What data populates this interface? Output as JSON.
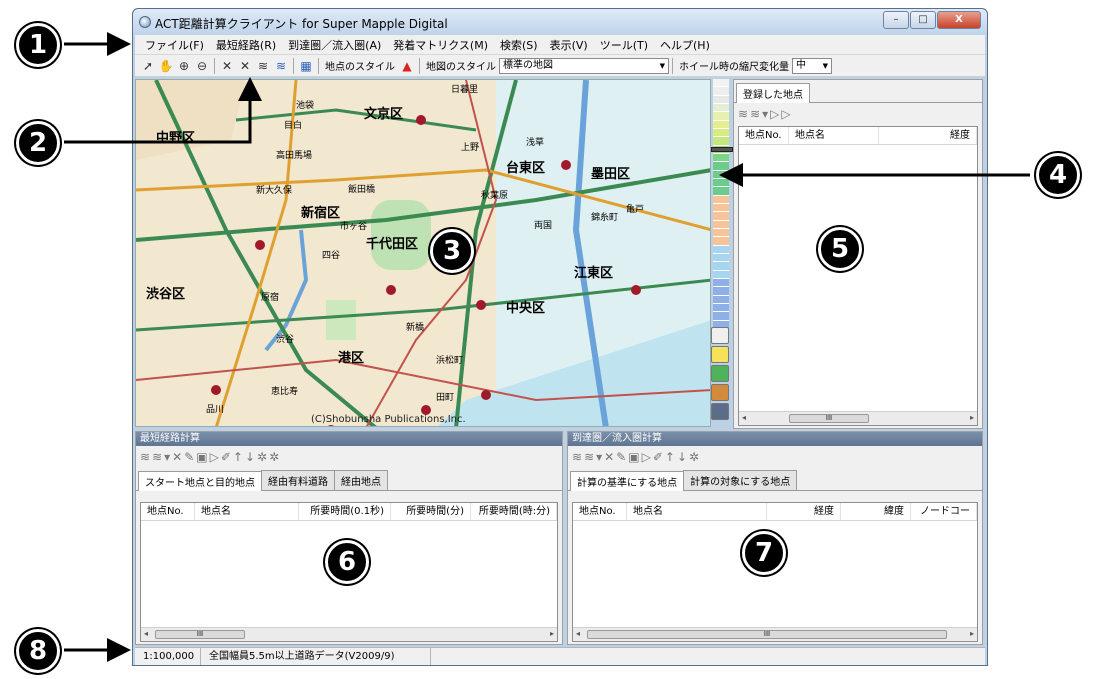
{
  "window": {
    "title": "ACT距離計算クライアント for Super Mapple Digital",
    "controls": [
      "–",
      "□",
      "X"
    ]
  },
  "menu": [
    "ファイル(F)",
    "最短経路(R)",
    "到達圏／流入圏(A)",
    "発着マトリクス(M)",
    "検索(S)",
    "表示(V)",
    "ツール(T)",
    "ヘルプ(H)"
  ],
  "toolbar": {
    "point_style_label": "地点のスタイル",
    "map_style_label": "地図のスタイル",
    "map_style_value": "標準の地図",
    "wheel_label": "ホイール時の縮尺変化量",
    "wheel_value": "中"
  },
  "map": {
    "copyright": "(C)Shobunsha Publications,Inc.",
    "labels": [
      "中野区",
      "文京区",
      "台東区",
      "墨田区",
      "新宿区",
      "千代田区",
      "江東区",
      "渋谷区",
      "中央区",
      "港区",
      "目白",
      "新大久保",
      "飯田橋",
      "市ヶ谷",
      "秋葉原",
      "上野",
      "浅草",
      "日暮里",
      "両国",
      "新橋",
      "浜松町",
      "恵比寿",
      "原宿",
      "渋谷",
      "四谷",
      "高田馬場",
      "池袋",
      "亀戸",
      "錦糸町",
      "田町",
      "品川"
    ]
  },
  "registered_panel": {
    "tab": "登録した地点",
    "columns": [
      "地点No.",
      "地点名",
      "経度"
    ]
  },
  "shortest_panel": {
    "title": "最短経路計算",
    "tabs": [
      "スタート地点と目的地点",
      "経由有料道路",
      "経由地点"
    ],
    "columns": [
      "地点No.",
      "地点名",
      "所要時間(0.1秒)",
      "所要時間(分)",
      "所要時間(時:分)"
    ]
  },
  "reach_panel": {
    "title": "到達圏／流入圏計算",
    "tabs": [
      "計算の基準にする地点",
      "計算の対象にする地点"
    ],
    "columns": [
      "地点No.",
      "地点名",
      "経度",
      "緯度",
      "ノードコー"
    ]
  },
  "status": {
    "scale": "1:100,000",
    "data": "全国幅員5.5m以上道路データ(V2009/9)"
  },
  "callouts": [
    "1",
    "2",
    "3",
    "4",
    "5",
    "6",
    "7",
    "8"
  ],
  "scroll_mark": "III"
}
